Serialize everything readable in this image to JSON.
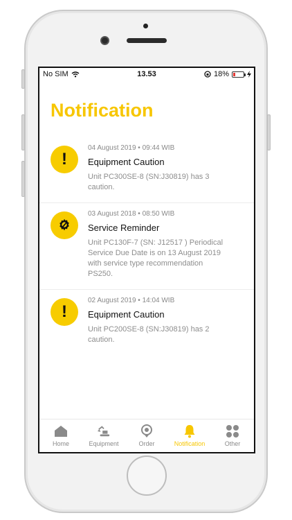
{
  "status_bar": {
    "carrier": "No SIM",
    "time": "13.53",
    "battery": "18%",
    "battery_level": 0.18
  },
  "page": {
    "title": "Notification"
  },
  "notifications": [
    {
      "icon": "exclamation-icon",
      "meta": "04 August 2019 • 09:44 WIB",
      "title": "Equipment Caution",
      "message": "Unit PC300SE-8 (SN:J30819) has 3 caution."
    },
    {
      "icon": "gear-wrench-icon",
      "meta": "03 August 2018 • 08:50 WIB",
      "title": "Service Reminder",
      "message": "Unit PC130F-7 (SN: J12517 ) Periodical Service Due Date is on 13 August 2019 with service type recommendation PS250."
    },
    {
      "icon": "exclamation-icon",
      "meta": "02 August 2019 • 14:04 WIB",
      "title": "Equipment Caution",
      "message": "Unit PC200SE-8 (SN:J30819) has 2 caution."
    }
  ],
  "tabs": [
    {
      "label": "Home",
      "icon": "home-icon"
    },
    {
      "label": "Equipment",
      "icon": "excavator-icon"
    },
    {
      "label": "Order",
      "icon": "order-icon"
    },
    {
      "label": "Notification",
      "icon": "bell-icon",
      "active": true
    },
    {
      "label": "Other",
      "icon": "grid-icon"
    }
  ],
  "colors": {
    "accent": "#f7c600",
    "icon_bg": "#f7cc00",
    "inactive": "#8a8a8a"
  }
}
